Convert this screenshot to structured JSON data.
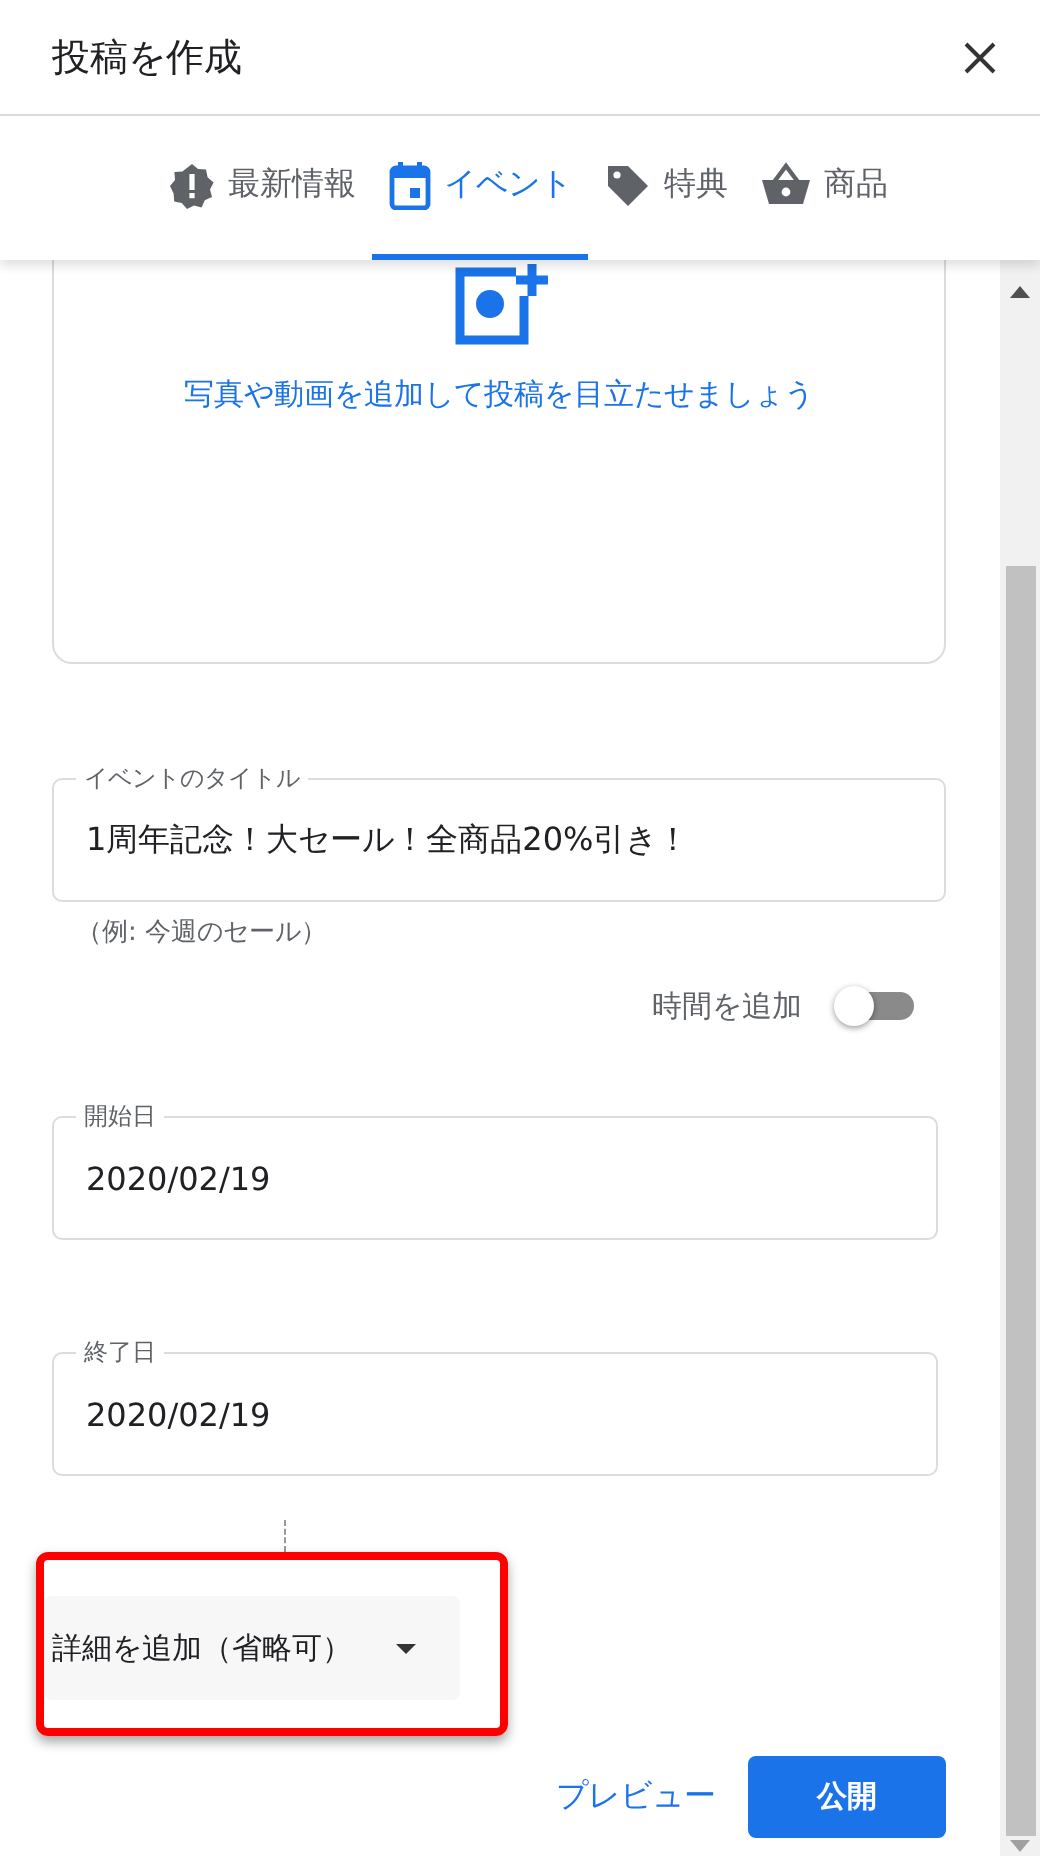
{
  "dialog": {
    "title": "投稿を作成"
  },
  "tabs": [
    {
      "kind": "alert",
      "label": "最新情報",
      "selected": false
    },
    {
      "kind": "calendar",
      "label": "イベント",
      "selected": true
    },
    {
      "kind": "tag",
      "label": "特典",
      "selected": false
    },
    {
      "kind": "basket",
      "label": "商品",
      "selected": false
    }
  ],
  "upload": {
    "prompt": "写真や動画を追加して投稿を目立たせましょう"
  },
  "title_field": {
    "label": "イベントのタイトル",
    "value": "1周年記念！大セール！全商品20%引き！",
    "helper": "（例: 今週のセール）"
  },
  "time_toggle": {
    "label": "時間を追加",
    "on": false
  },
  "date_fields": [
    {
      "label": "開始日",
      "value": "2020/02/19"
    },
    {
      "label": "終了日",
      "value": "2020/02/19"
    }
  ],
  "details_button": {
    "label": "詳細を追加（省略可）",
    "highlighted": true
  },
  "actions": {
    "preview": "プレビュー",
    "publish": "公開"
  }
}
